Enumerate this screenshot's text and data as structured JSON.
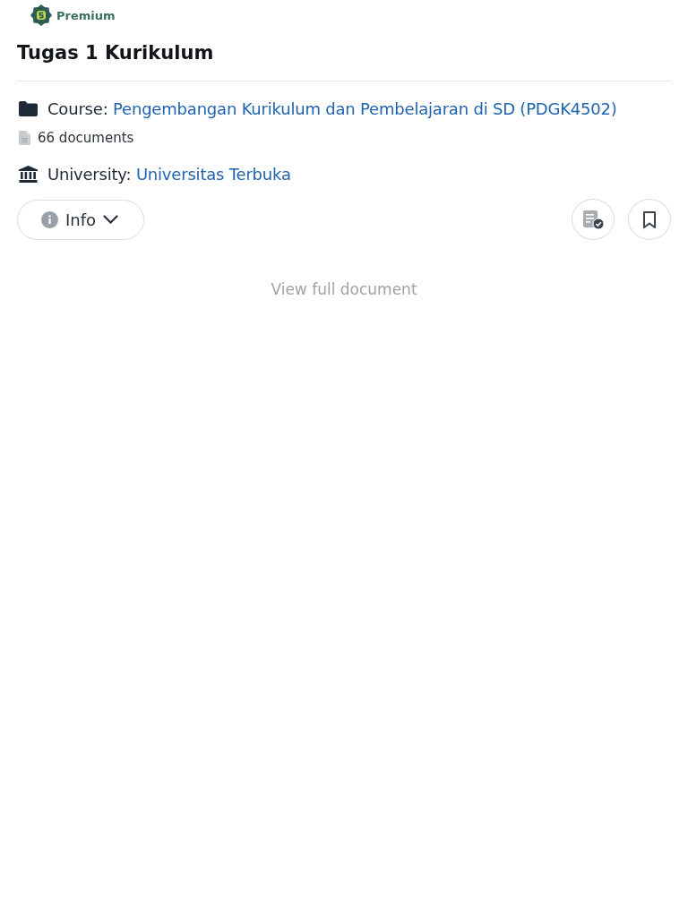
{
  "badge": {
    "label": "Premium"
  },
  "title": "Tugas 1 Kurikulum",
  "meta": [
    {
      "kind": "course",
      "label": "Course:",
      "value": "Pengembangan Kurikulum dan Pembelajaran di SD (PDGK4502)"
    },
    {
      "kind": "documents",
      "text": "66 documents"
    },
    {
      "kind": "university",
      "label": "University:",
      "value": "Universitas Terbuka"
    }
  ],
  "info_button": {
    "label": "Info",
    "expanded": false
  },
  "view_full": "View full document"
}
